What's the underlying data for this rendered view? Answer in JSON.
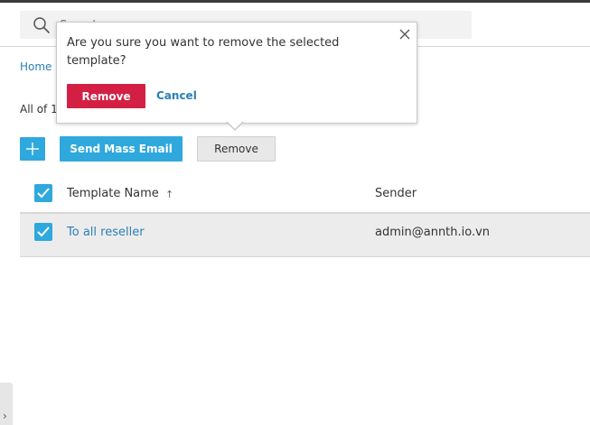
{
  "search": {
    "placeholder": "Search"
  },
  "breadcrumb": {
    "home": "Home"
  },
  "list": {
    "count_text": "All of 1"
  },
  "toolbar": {
    "add_label": "+",
    "mass_email_label": "Send Mass Email",
    "remove_label": "Remove"
  },
  "table": {
    "columns": {
      "name": "Template Name",
      "sort_indicator": "↑",
      "sender": "Sender"
    },
    "rows": [
      {
        "name": "To all reseller",
        "sender": "admin@annth.io.vn",
        "selected": true
      }
    ]
  },
  "dialog": {
    "message": "Are you sure you want to remove the selected template?",
    "confirm_label": "Remove",
    "cancel_label": "Cancel",
    "close_icon": "close-icon"
  },
  "side_panel": {
    "toggle_icon": "chevron-right-icon",
    "glyph": "›"
  },
  "colors": {
    "accent": "#2fa8dd",
    "danger": "#d41f45",
    "link": "#2a7fb8"
  }
}
